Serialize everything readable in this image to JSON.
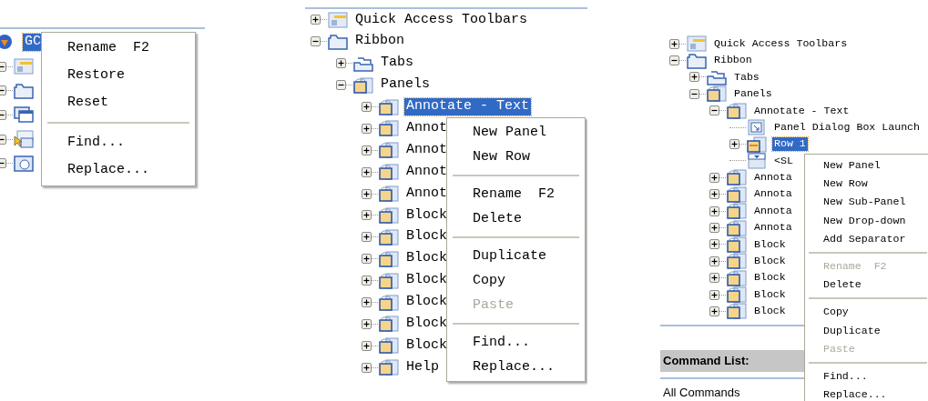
{
  "panels": [
    {
      "tree": [
        {
          "kind": "app",
          "label": "GC",
          "selected": true,
          "children": [
            {
              "kind": "toolbar",
              "expanded": true
            },
            {
              "kind": "ribbon",
              "expanded": true
            },
            {
              "kind": "window",
              "expanded": true
            },
            {
              "kind": "pointer",
              "expanded": true
            },
            {
              "kind": "disc",
              "expanded": true
            }
          ]
        }
      ],
      "context_menu": [
        {
          "kind": "item",
          "label": "Rename",
          "shortcut": "F2",
          "disabled": false
        },
        {
          "kind": "item",
          "label": "Restore",
          "disabled": false
        },
        {
          "kind": "item",
          "label": "Reset",
          "disabled": false
        },
        {
          "kind": "separator"
        },
        {
          "kind": "item",
          "label": "Find...",
          "disabled": false
        },
        {
          "kind": "item",
          "label": "Replace...",
          "disabled": false
        }
      ]
    },
    {
      "tree": [
        {
          "kind": "toolbar",
          "label": "Quick Access Toolbars",
          "selected": false,
          "expanded": false
        },
        {
          "kind": "ribbon",
          "label": "Ribbon",
          "selected": false,
          "expanded": true,
          "children": [
            {
              "kind": "tabs",
              "label": "Tabs",
              "selected": false,
              "expanded": false
            },
            {
              "kind": "panel",
              "label": "Panels",
              "selected": false,
              "expanded": true,
              "children": [
                {
                  "kind": "panel",
                  "label": "Annotate - Text",
                  "selected": true,
                  "expanded": false
                },
                {
                  "kind": "panel",
                  "label": "Annot",
                  "selected": false,
                  "expanded": false
                },
                {
                  "kind": "panel",
                  "label": "Annot",
                  "selected": false,
                  "expanded": false
                },
                {
                  "kind": "panel",
                  "label": "Annot",
                  "selected": false,
                  "expanded": false
                },
                {
                  "kind": "panel",
                  "label": "Annot",
                  "selected": false,
                  "expanded": false
                },
                {
                  "kind": "panel",
                  "label": "Block",
                  "selected": false,
                  "expanded": false
                },
                {
                  "kind": "panel",
                  "label": "Block",
                  "selected": false,
                  "expanded": false
                },
                {
                  "kind": "panel",
                  "label": "Block",
                  "selected": false,
                  "expanded": false
                },
                {
                  "kind": "panel",
                  "label": "Block",
                  "selected": false,
                  "expanded": false
                },
                {
                  "kind": "panel",
                  "label": "Block",
                  "selected": false,
                  "expanded": false
                },
                {
                  "kind": "panel",
                  "label": "Block",
                  "selected": false,
                  "expanded": false
                },
                {
                  "kind": "panel",
                  "label": "Block",
                  "selected": false,
                  "expanded": false
                },
                {
                  "kind": "panel",
                  "label": "Help",
                  "selected": false,
                  "expanded": false
                }
              ]
            }
          ]
        }
      ],
      "context_menu": [
        {
          "kind": "item",
          "label": "New Panel",
          "disabled": false
        },
        {
          "kind": "item",
          "label": "New Row",
          "disabled": false
        },
        {
          "kind": "separator"
        },
        {
          "kind": "item",
          "label": "Rename",
          "shortcut": "F2",
          "disabled": false
        },
        {
          "kind": "item",
          "label": "Delete",
          "disabled": false
        },
        {
          "kind": "separator"
        },
        {
          "kind": "item",
          "label": "Duplicate",
          "disabled": false
        },
        {
          "kind": "item",
          "label": "Copy",
          "disabled": false
        },
        {
          "kind": "item",
          "label": "Paste",
          "disabled": true
        },
        {
          "kind": "separator"
        },
        {
          "kind": "item",
          "label": "Find...",
          "disabled": false
        },
        {
          "kind": "item",
          "label": "Replace...",
          "disabled": false
        }
      ]
    },
    {
      "tree": [
        {
          "kind": "toolbar",
          "label": "Quick Access Toolbars",
          "selected": false,
          "expanded": false
        },
        {
          "kind": "ribbon",
          "label": "Ribbon",
          "selected": false,
          "expanded": true,
          "children": [
            {
              "kind": "tabs",
              "label": "Tabs",
              "selected": false,
              "expanded": false
            },
            {
              "kind": "panel",
              "label": "Panels",
              "selected": false,
              "expanded": true,
              "children": [
                {
                  "kind": "panel",
                  "label": "Annotate - Text",
                  "selected": false,
                  "expanded": true,
                  "children": [
                    {
                      "kind": "launcher",
                      "label": "Panel Dialog Box Launch",
                      "selected": false
                    },
                    {
                      "kind": "row",
                      "label": "Row 1",
                      "selected": true,
                      "expanded": false
                    },
                    {
                      "kind": "dropdown",
                      "label": "<SL",
                      "selected": false
                    }
                  ]
                },
                {
                  "kind": "panel",
                  "label": "Annota",
                  "selected": false,
                  "expanded": false
                },
                {
                  "kind": "panel",
                  "label": "Annota",
                  "selected": false,
                  "expanded": false
                },
                {
                  "kind": "panel",
                  "label": "Annota",
                  "selected": false,
                  "expanded": false
                },
                {
                  "kind": "panel",
                  "label": "Annota",
                  "selected": false,
                  "expanded": false
                },
                {
                  "kind": "panel",
                  "label": "Block",
                  "selected": false,
                  "expanded": false
                },
                {
                  "kind": "panel",
                  "label": "Block",
                  "selected": false,
                  "expanded": false
                },
                {
                  "kind": "panel",
                  "label": "Block",
                  "selected": false,
                  "expanded": false
                },
                {
                  "kind": "panel",
                  "label": "Block",
                  "selected": false,
                  "expanded": false
                },
                {
                  "kind": "panel",
                  "label": "Block",
                  "selected": false,
                  "expanded": false
                }
              ]
            }
          ]
        }
      ],
      "command_list": {
        "title": "Command List:",
        "value": "All Commands"
      },
      "context_menu": [
        {
          "kind": "item",
          "label": "New Panel",
          "disabled": false
        },
        {
          "kind": "item",
          "label": "New Row",
          "disabled": false
        },
        {
          "kind": "item",
          "label": "New Sub-Panel",
          "disabled": false
        },
        {
          "kind": "item",
          "label": "New Drop-down",
          "disabled": false
        },
        {
          "kind": "item",
          "label": "Add Separator",
          "disabled": false
        },
        {
          "kind": "separator"
        },
        {
          "kind": "item",
          "label": "Rename",
          "shortcut": "F2",
          "disabled": true
        },
        {
          "kind": "item",
          "label": "Delete",
          "disabled": false
        },
        {
          "kind": "separator"
        },
        {
          "kind": "item",
          "label": "Copy",
          "disabled": false
        },
        {
          "kind": "item",
          "label": "Duplicate",
          "disabled": false
        },
        {
          "kind": "item",
          "label": "Paste",
          "disabled": true
        },
        {
          "kind": "separator"
        },
        {
          "kind": "item",
          "label": "Find...",
          "disabled": false
        },
        {
          "kind": "item",
          "label": "Replace...",
          "disabled": false
        }
      ]
    }
  ]
}
